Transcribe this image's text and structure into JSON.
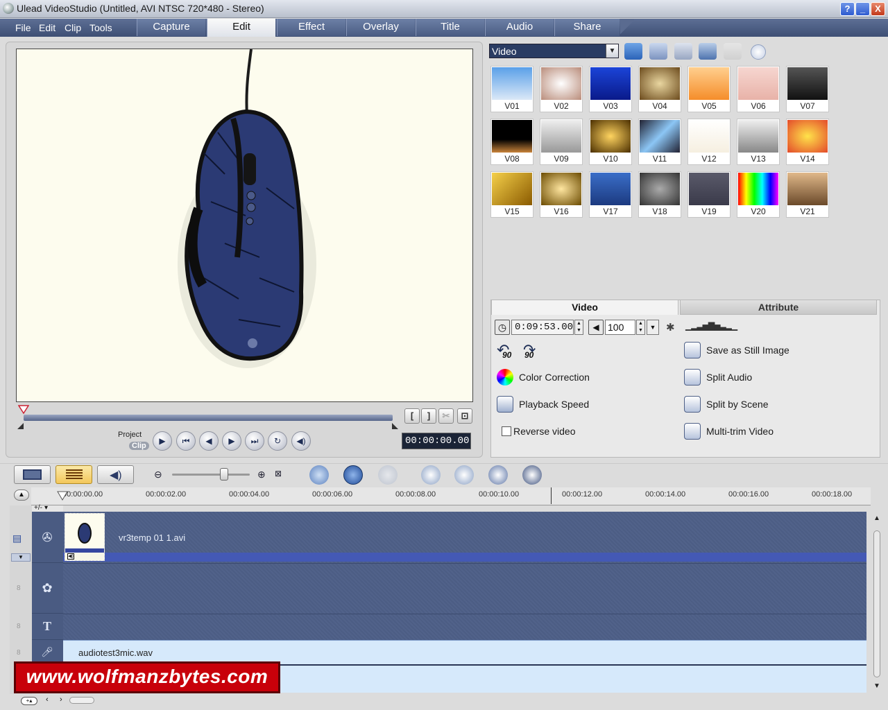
{
  "window": {
    "title": "Ulead VideoStudio (Untitled, AVI NTSC 720*480 - Stereo)",
    "help": "?",
    "minimize": "_",
    "close": "X"
  },
  "menu": [
    "File",
    "Edit",
    "Clip",
    "Tools"
  ],
  "tabs": [
    {
      "label": "Capture",
      "active": false
    },
    {
      "label": "Edit",
      "active": true
    },
    {
      "label": "Effect",
      "active": false
    },
    {
      "label": "Overlay",
      "active": false
    },
    {
      "label": "Title",
      "active": false
    },
    {
      "label": "Audio",
      "active": false
    },
    {
      "label": "Share",
      "active": false
    }
  ],
  "player": {
    "project_label": "Project",
    "clip_label": "Clip",
    "timecode": "00:00:00.00",
    "mark_in": "[",
    "mark_out": "]",
    "playback_progress": 0
  },
  "library": {
    "selected": "Video",
    "thumbnails": [
      "V01",
      "V02",
      "V03",
      "V04",
      "V05",
      "V06",
      "V07",
      "V08",
      "V09",
      "V10",
      "V11",
      "V12",
      "V13",
      "V14",
      "V15",
      "V16",
      "V17",
      "V18",
      "V19",
      "V20",
      "V21"
    ]
  },
  "options": {
    "tabs": [
      "Video",
      "Attribute"
    ],
    "duration": "0:09:53.00",
    "volume": "100",
    "rotate_left": "90",
    "rotate_right": "90",
    "color_correction": "Color Correction",
    "playback_speed": "Playback Speed",
    "reverse_video": "Reverse video",
    "reverse_checked": false,
    "save_still": "Save as Still Image",
    "split_audio": "Split Audio",
    "split_scene": "Split by Scene",
    "multi_trim": "Multi-trim Video"
  },
  "timeline": {
    "ruler": [
      "00:00:00.00",
      "00:00:02.00",
      "00:00:04.00",
      "00:00:06.00",
      "00:00:08.00",
      "00:00:10.00",
      "00:00:12.00",
      "00:00:14.00",
      "00:00:16.00",
      "00:00:18.00"
    ],
    "add_label": "+/-",
    "video_clip": "vr3temp 01 1.avi",
    "audio_clip": "audiotest3mic.wav",
    "title_track_icon": "T"
  },
  "watermark": "www.wolfmanzbytes.com",
  "colors": {
    "accent": "#3e4f74",
    "timeline_track": "#4c5d84",
    "audio_track": "#d6e9fb",
    "watermark_bg": "#c8000a"
  }
}
